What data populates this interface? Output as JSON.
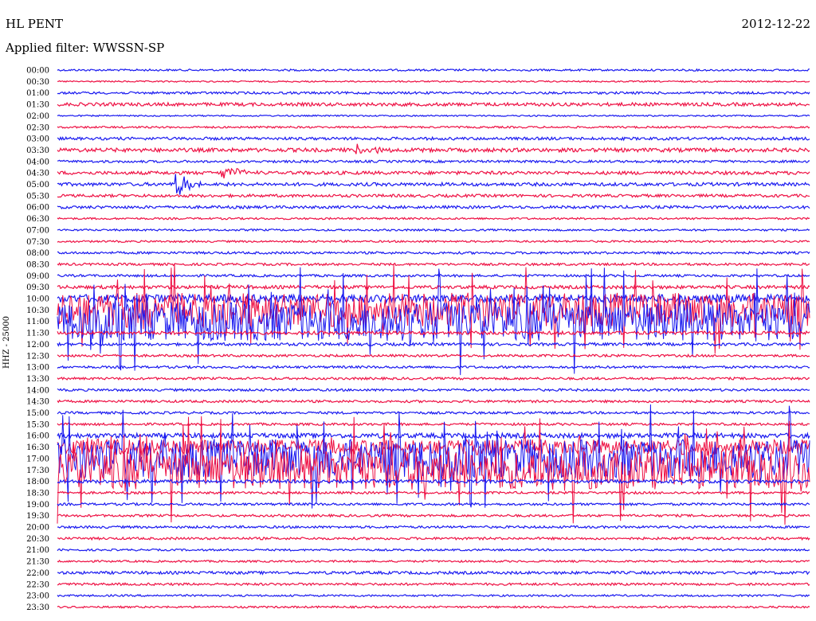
{
  "header": {
    "station": "HL PENT",
    "date": "2012-12-22",
    "filter": "Applied filter: WWSSN-SP"
  },
  "chart_data": {
    "type": "line",
    "title": "HL PENT",
    "ylabel": "HHZ - 25000",
    "colors": {
      "odd": "#1a1af0",
      "even": "#ee1144"
    },
    "rows": [
      {
        "time": "00:00",
        "activity": 0.02
      },
      {
        "time": "00:30",
        "activity": 0.01
      },
      {
        "time": "01:00",
        "activity": 0.03
      },
      {
        "time": "01:30",
        "activity": 0.05
      },
      {
        "time": "02:00",
        "activity": 0.01
      },
      {
        "time": "02:30",
        "activity": 0.02
      },
      {
        "time": "03:00",
        "activity": 0.04
      },
      {
        "time": "03:30",
        "activity": 0.06
      },
      {
        "time": "04:00",
        "activity": 0.03
      },
      {
        "time": "04:30",
        "activity": 0.05
      },
      {
        "time": "05:00",
        "activity": 0.05
      },
      {
        "time": "05:30",
        "activity": 0.04
      },
      {
        "time": "06:00",
        "activity": 0.04
      },
      {
        "time": "06:30",
        "activity": 0.02
      },
      {
        "time": "07:00",
        "activity": 0.02
      },
      {
        "time": "07:30",
        "activity": 0.02
      },
      {
        "time": "08:00",
        "activity": 0.03
      },
      {
        "time": "08:30",
        "activity": 0.03
      },
      {
        "time": "09:00",
        "activity": 0.03
      },
      {
        "time": "09:30",
        "activity": 0.05
      },
      {
        "time": "10:00",
        "activity": 0.15
      },
      {
        "time": "10:30",
        "activity": 0.7
      },
      {
        "time": "11:00",
        "activity": 0.8
      },
      {
        "time": "11:30",
        "activity": 0.05
      },
      {
        "time": "12:00",
        "activity": 0.04
      },
      {
        "time": "12:30",
        "activity": 0.03
      },
      {
        "time": "13:00",
        "activity": 0.03
      },
      {
        "time": "13:30",
        "activity": 0.03
      },
      {
        "time": "14:00",
        "activity": 0.03
      },
      {
        "time": "14:30",
        "activity": 0.03
      },
      {
        "time": "15:00",
        "activity": 0.03
      },
      {
        "time": "15:30",
        "activity": 0.03
      },
      {
        "time": "16:00",
        "activity": 0.08
      },
      {
        "time": "16:30",
        "activity": 0.3
      },
      {
        "time": "17:00",
        "activity": 0.8
      },
      {
        "time": "17:30",
        "activity": 0.8
      },
      {
        "time": "18:00",
        "activity": 0.05
      },
      {
        "time": "18:30",
        "activity": 0.03
      },
      {
        "time": "19:00",
        "activity": 0.03
      },
      {
        "time": "19:30",
        "activity": 0.03
      },
      {
        "time": "20:00",
        "activity": 0.03
      },
      {
        "time": "20:30",
        "activity": 0.03
      },
      {
        "time": "21:00",
        "activity": 0.02
      },
      {
        "time": "21:30",
        "activity": 0.02
      },
      {
        "time": "22:00",
        "activity": 0.04
      },
      {
        "time": "22:30",
        "activity": 0.03
      },
      {
        "time": "23:00",
        "activity": 0.02
      },
      {
        "time": "23:30",
        "activity": 0.02
      }
    ],
    "events": [
      {
        "time": "03:30",
        "x_frac": 0.4,
        "amplitude": 0.5
      },
      {
        "time": "04:30",
        "x_frac": 0.22,
        "amplitude": 0.6
      },
      {
        "time": "05:00",
        "x_frac": 0.16,
        "amplitude": 0.9
      }
    ],
    "grid": false,
    "legend": "none"
  }
}
